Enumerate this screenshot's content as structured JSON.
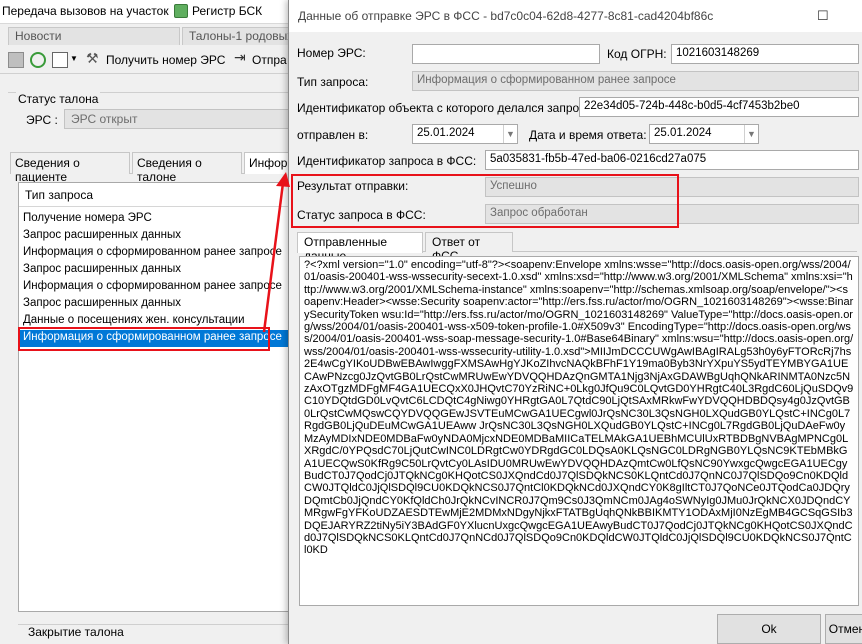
{
  "main": {
    "topbar": {
      "item1": "Передача вызовов на участок",
      "item2": "Регистр БСК"
    },
    "tabs": [
      "Новости",
      "Талоны-1 родовых"
    ],
    "toolbar": {
      "get_number": "Получить номер ЭРС",
      "send": "Отпра"
    },
    "status_group": {
      "title": "Статус талона",
      "ers_label": "ЭРС :",
      "ers_value": "ЭРС открыт"
    },
    "subtabs": [
      "Сведения о пациенте",
      "Сведения о талоне",
      "Инфор"
    ],
    "list": {
      "header": "Тип запроса",
      "rows": [
        "Получение номера ЭРС",
        "Запрос расширенных данных",
        "Информация о сформированном ранее запросе",
        "Запрос расширенных данных",
        "Информация о сформированном ранее запросе",
        "Запрос расширенных данных",
        "Данные о посещениях жен. консультации",
        "Информация о сформированном ранее запросе"
      ],
      "selected_index": 7
    },
    "bottom_group": "Закрытие талона"
  },
  "dialog": {
    "title": "Данные об отправке ЭРС в ФСС - bd7c0c04-62d8-4277-8c81-cad4204bf86c",
    "ers_number": {
      "label": "Номер ЭРС:",
      "value": ""
    },
    "ogrn": {
      "label": "Код ОГРН:",
      "value": "1021603148269"
    },
    "request_type": {
      "label": "Тип запроса:",
      "value": "Информация о сформированном ранее запросе"
    },
    "object_id": {
      "label": "Идентификатор объекта с которого делался запрос:",
      "value": "22e34d05-724b-448c-b0d5-4cf7453b2be0"
    },
    "sent": {
      "label": "отправлен в:",
      "value": "25.01.2024"
    },
    "answer_date": {
      "label": "Дата и время ответа:",
      "value": "25.01.2024"
    },
    "fss_request_id": {
      "label": "Идентификатор запроса в ФСС:",
      "value": "5a035831-fb5b-47ed-ba06-0216cd27a075"
    },
    "send_result": {
      "label": "Результат отправки:",
      "value": "Успешно"
    },
    "fss_status": {
      "label": "Статус запроса в ФСС:",
      "value": "Запрос обработан"
    },
    "tabs": [
      "Отправленные данные",
      "Ответ от ФСС"
    ],
    "xml_text": "?<?xml version=\"1.0\" encoding=\"utf-8\"?><soapenv:Envelope xmlns:wsse=\"http://docs.oasis-open.org/wss/2004/01/oasis-200401-wss-wssecurity-secext-1.0.xsd\" xmlns:xsd=\"http://www.w3.org/2001/XMLSchema\" xmlns:xsi=\"http://www.w3.org/2001/XMLSchema-instance\" xmlns:soapenv=\"http://schemas.xmlsoap.org/soap/envelope/\"><soapenv:Header><wsse:Security soapenv:actor=\"http://ers.fss.ru/actor/mo/OGRN_1021603148269\"><wsse:BinarySecurityToken wsu:Id=\"http://ers.fss.ru/actor/mo/OGRN_1021603148269\" ValueType=\"http://docs.oasis-open.org/wss/2004/01/oasis-200401-wss-x509-token-profile-1.0#X509v3\" EncodingType=\"http://docs.oasis-open.org/wss/2004/01/oasis-200401-wss-soap-message-security-1.0#Base64Binary\" xmlns:wsu=\"http://docs.oasis-open.org/wss/2004/01/oasis-200401-wss-wssecurity-utility-1.0.xsd\">MIIJmDCCCUWgAwIBAgIRALg53h0y6yFTORcRj7hs2E4wCgYIKoUDBwEBAwIwggFXMSAwHgYJKoZIhvcNAQkBFhF1Y19ma0Byb3NrYXpuYS5ydTEYMBYGA1UECAwPNzcg0JzQvtGB0LrQstCwMRUwEwYDVQQHDAzQnGMTA1Njg3NjAxGDAWBgUqhQNkARINMTA0Nzc5NzAxOTgzMDFgMF4GA1UECQxX0JHQvtC70YzRiNC+0Lkg0JfQu9C0LQvtGD0YHRgtC40L3RgdC60LjQuSDQv9C10YDQtdGD0LvQvtC6LCDQtC4gNiwg0YHRgtGA0L7QtdC90LjQtSAxMRkwFwYDVQQHDBDQsy4g0JzQvtGB0LrQstCwMQswCQYDVQQGEwJSVTEuMCwGA1UECgwl0JrQsNC30L3QsNGH0LXQudGB0YLQstC+INCg0L7RgdGB0LjQuDEuMCwGA1UEAww JrQsNC30L3QsNGH0LXQudGB0YLQstC+INCg0L7RgdGB0LjQuDAeFw0yMzAyMDIxNDE0MDBaFw0yNDA0MjcxNDE0MDBaMIICaTELMAkGA1UEBhMCUlUxRTBDBgNVBAgMPNCg0LXRgdC/0YPQsdC70LjQutCwINC0LDRgtCw0YDRgdGC0LDQsA0KLQsNGC0LDRgNGB0YLQsNC9KTEbMBkGA1UECQwS0KfRg9C50LrQvtCy0LAsIDU0MRUwEwYDVQQHDAzQmtCw0LfQsNC90YwxgcQwgcEGA1UECgyBudCT0J7QodCj0JTQkNCg0KHQotCS0JXQndCd0J7QlSDQkNCS0KLQntCd0J7QnNC0J7QlSDQo9Cn0KDQldCW0JTQldC0JjQlSDQl9CU0KDQkNCS0J7QntCl0KDQkNCd0JXQndCY0K8gIltCT0J7QoNCe0JTQodCa0JDQryDQmtCb0JjQndCY0KfQldCh0JrQkNCvINCR0J7Qm9Cs0J3QmNCm0JAg4oSWNyIg0JMu0JrQkNCX0JDQndCYMRgwFgYFKoUDZAESDTEwMjE2MDMxNDgyNjkxFTATBgUqhQNkBBIKMTY1ODAxMjI0NzEgMB4GCSqGSIb3DQEJARYRZ2tiNy5iY3BAdGF0YXlucnUxgcQwgcEGA1UEAwyBudCT0J7QodCj0JTQkNCg0KHQotCS0JXQndCd0J7QlSDQkNCS0KLQntCd0J7QnNCd0J7QlSDQo9Cn0KDQldCW0JTQldC0JjQlSDQl9CU0KDQkNCS0J7QntCl0KD",
    "buttons": {
      "ok": "Ok",
      "cancel": "Отмен"
    },
    "accent_color": "#e8121a"
  }
}
